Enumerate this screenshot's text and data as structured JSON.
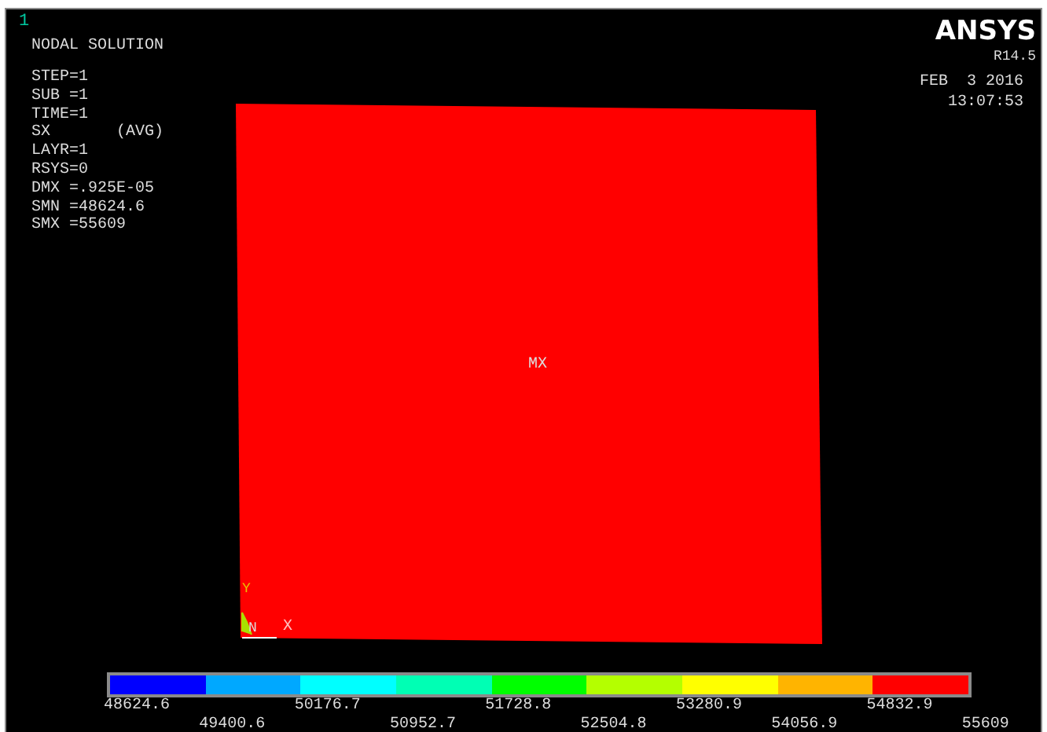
{
  "window_number": "1",
  "title": "NODAL SOLUTION",
  "info": [
    {
      "text": "STEP=1"
    },
    {
      "text": "SUB =1"
    },
    {
      "text": "TIME=1"
    },
    {
      "text": "SX",
      "note": "(AVG)"
    },
    {
      "text": "LAYR=1"
    },
    {
      "text": "RSYS=0"
    },
    {
      "text": "DMX =.925E-05"
    },
    {
      "text": "SMN =48624.6"
    },
    {
      "text": "SMX =55609"
    }
  ],
  "logo": "ANSYS",
  "version": "R14.5",
  "date": "FEB  3 2016",
  "time": "13:07:53",
  "plot": {
    "max_label": "MX",
    "triad": {
      "y": "Y",
      "n": "N",
      "x": "X"
    }
  },
  "legend": {
    "segments": [
      {
        "color": "#0000ff"
      },
      {
        "color": "#00a8ff"
      },
      {
        "color": "#00ffff"
      },
      {
        "color": "#00ffb4"
      },
      {
        "color": "#00ff00"
      },
      {
        "color": "#b4ff00"
      },
      {
        "color": "#ffff00"
      },
      {
        "color": "#ffb400"
      },
      {
        "color": "#ff0000"
      }
    ],
    "labels": [
      "48624.6",
      "49400.6",
      "50176.7",
      "50952.7",
      "51728.8",
      "52504.8",
      "53280.9",
      "54056.9",
      "54832.9",
      "55609"
    ]
  }
}
